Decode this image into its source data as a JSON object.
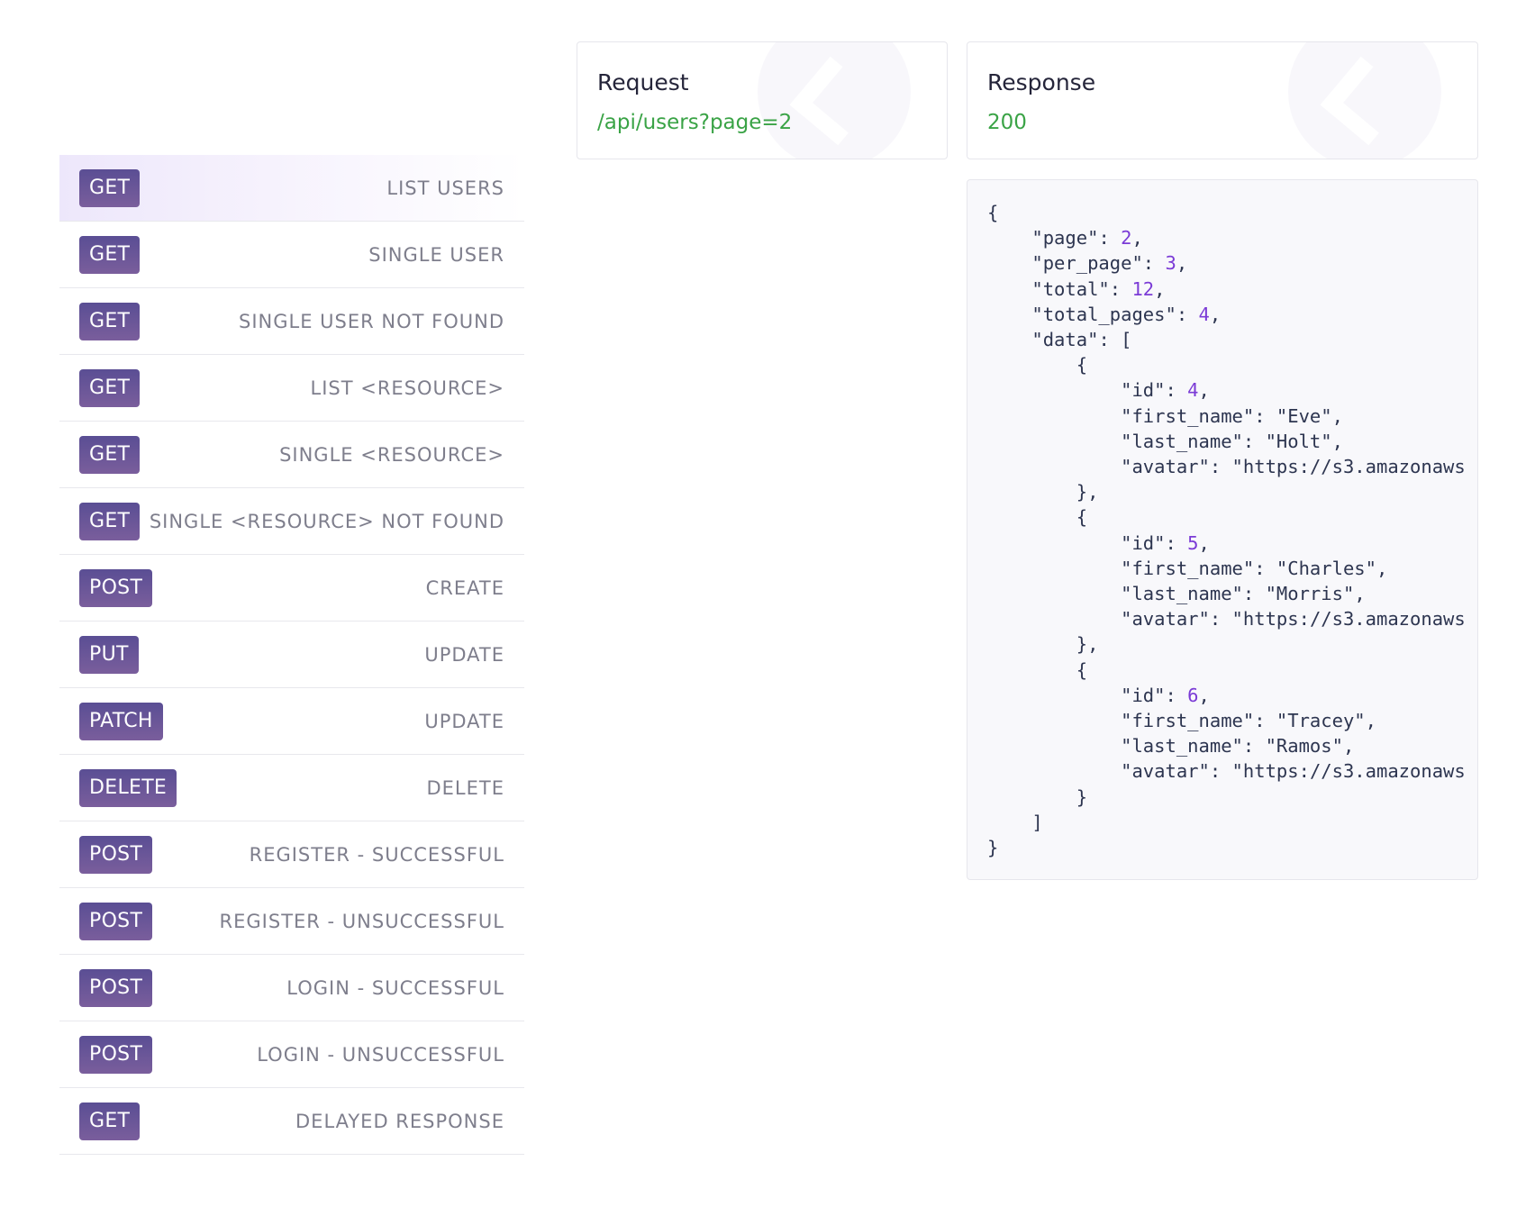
{
  "endpoints": [
    {
      "method": "GET",
      "label": "LIST USERS",
      "active": true
    },
    {
      "method": "GET",
      "label": "SINGLE USER"
    },
    {
      "method": "GET",
      "label": "SINGLE USER NOT FOUND"
    },
    {
      "method": "GET",
      "label": "LIST <RESOURCE>"
    },
    {
      "method": "GET",
      "label": "SINGLE <RESOURCE>"
    },
    {
      "method": "GET",
      "label": "SINGLE <RESOURCE> NOT FOUND"
    },
    {
      "method": "POST",
      "label": "CREATE"
    },
    {
      "method": "PUT",
      "label": "UPDATE"
    },
    {
      "method": "PATCH",
      "label": "UPDATE"
    },
    {
      "method": "DELETE",
      "label": "DELETE"
    },
    {
      "method": "POST",
      "label": "REGISTER - SUCCESSFUL"
    },
    {
      "method": "POST",
      "label": "REGISTER - UNSUCCESSFUL"
    },
    {
      "method": "POST",
      "label": "LOGIN - SUCCESSFUL"
    },
    {
      "method": "POST",
      "label": "LOGIN - UNSUCCESSFUL"
    },
    {
      "method": "GET",
      "label": "DELAYED RESPONSE"
    }
  ],
  "request": {
    "title": "Request",
    "url": "/api/users?page=2"
  },
  "response": {
    "title": "Response",
    "status": "200",
    "body": {
      "page": 2,
      "per_page": 3,
      "total": 12,
      "total_pages": 4,
      "data": [
        {
          "id": 4,
          "first_name": "Eve",
          "last_name": "Holt",
          "avatar": "https://s3.amazonaws"
        },
        {
          "id": 5,
          "first_name": "Charles",
          "last_name": "Morris",
          "avatar": "https://s3.amazonaws"
        },
        {
          "id": 6,
          "first_name": "Tracey",
          "last_name": "Ramos",
          "avatar": "https://s3.amazonaws"
        }
      ]
    }
  },
  "colors": {
    "method_badge": "#5f5196",
    "active_row": "#ede7fb",
    "request_url": "#3aa346",
    "status_code": "#3aa346",
    "json_number": "#7b3bd6",
    "json_text": "#2d3550"
  }
}
